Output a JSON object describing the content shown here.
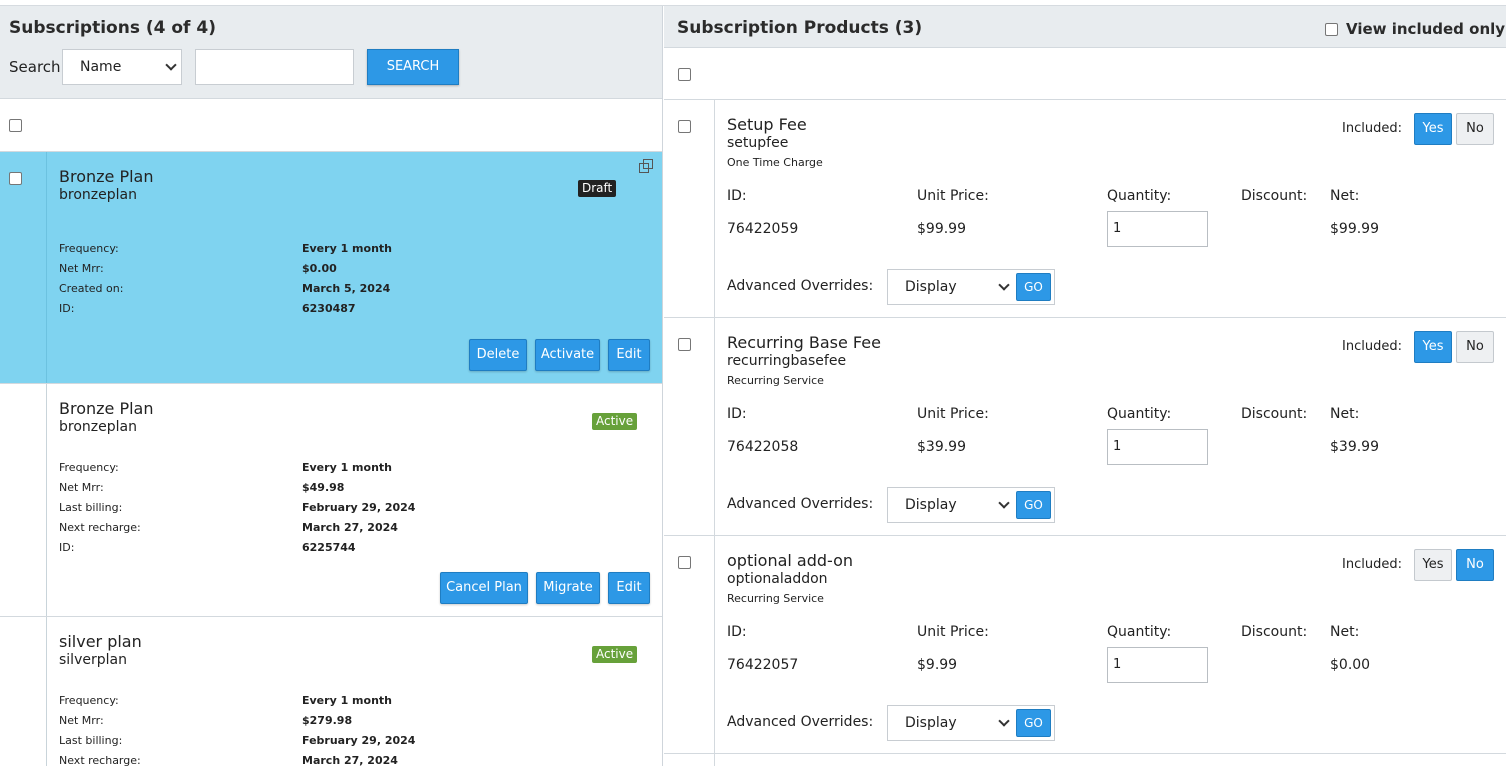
{
  "subscriptions": {
    "title": "Subscriptions (4 of 4)",
    "search_label": "Search:",
    "search_field_value": "Name",
    "search_input_value": "",
    "search_button": "SEARCH",
    "items": [
      {
        "name": "Bronze Plan",
        "code": "bronzeplan",
        "status": "Draft",
        "fields": [
          {
            "label": "Frequency:",
            "value": "Every 1 month"
          },
          {
            "label": "Net Mrr:",
            "value": "$0.00"
          },
          {
            "label": "Created on:",
            "value": "March 5, 2024"
          },
          {
            "label": "ID:",
            "value": "6230487"
          }
        ],
        "buttons": [
          "Delete",
          "Activate",
          "Edit"
        ]
      },
      {
        "name": "Bronze Plan",
        "code": "bronzeplan",
        "status": "Active",
        "fields": [
          {
            "label": "Frequency:",
            "value": "Every 1 month"
          },
          {
            "label": "Net Mrr:",
            "value": "$49.98"
          },
          {
            "label": "Last billing:",
            "value": "February 29, 2024"
          },
          {
            "label": "Next recharge:",
            "value": "March 27, 2024"
          },
          {
            "label": "ID:",
            "value": "6225744"
          }
        ],
        "buttons": [
          "Cancel Plan",
          "Migrate",
          "Edit"
        ]
      },
      {
        "name": "silver plan",
        "code": "silverplan",
        "status": "Active",
        "fields": [
          {
            "label": "Frequency:",
            "value": "Every 1 month"
          },
          {
            "label": "Net Mrr:",
            "value": "$279.98"
          },
          {
            "label": "Last billing:",
            "value": "February 29, 2024"
          },
          {
            "label": "Next recharge:",
            "value": "March 27, 2024"
          }
        ]
      }
    ]
  },
  "products": {
    "title": "Subscription Products (3)",
    "view_included_label": "View included only",
    "included_label": "Included:",
    "yes_label": "Yes",
    "no_label": "No",
    "headers": {
      "id": "ID:",
      "unit_price": "Unit Price:",
      "quantity": "Quantity:",
      "discount": "Discount:",
      "net": "Net:"
    },
    "advanced_label": "Advanced Overrides:",
    "advanced_value": "Display",
    "go_label": "GO",
    "items": [
      {
        "name": "Setup Fee",
        "code": "setupfee",
        "type": "One Time Charge",
        "included": true,
        "id": "76422059",
        "unit_price": "$99.99",
        "quantity": "1",
        "net": "$99.99"
      },
      {
        "name": "Recurring Base Fee",
        "code": "recurringbasefee",
        "type": "Recurring Service",
        "included": true,
        "id": "76422058",
        "unit_price": "$39.99",
        "quantity": "1",
        "net": "$39.99"
      },
      {
        "name": "optional add-on",
        "code": "optionaladdon",
        "type": "Recurring Service",
        "included": false,
        "id": "76422057",
        "unit_price": "$9.99",
        "quantity": "1",
        "net": "$0.00"
      }
    ]
  },
  "colors": {
    "accent": "#2d98e6",
    "selected_row": "#7fd3f0",
    "active_badge": "#67a13a",
    "draft_badge": "#222222",
    "header_bg": "#e8ecef"
  }
}
